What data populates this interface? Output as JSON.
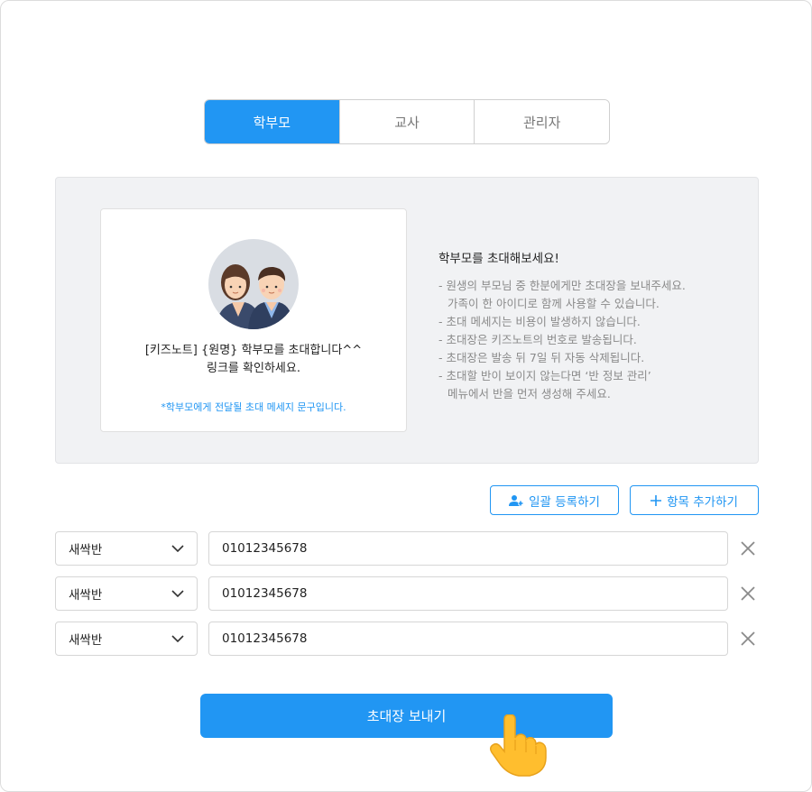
{
  "tabs": [
    {
      "label": "학부모",
      "active": true
    },
    {
      "label": "교사",
      "active": false
    },
    {
      "label": "관리자",
      "active": false
    }
  ],
  "preview": {
    "message_line1": "[키즈노트] {원명} 학부모를 초대합니다^^",
    "message_line2": "링크를 확인하세요.",
    "note": "*학부모에게 전달될 초대 메세지 문구입니다."
  },
  "info": {
    "title": "학부모를 초대해보세요!",
    "items": [
      "- 원생의 부모님 중 한분에게만 초대장을 보내주세요.",
      "가족이 한 아이디로 함께 사용할 수 있습니다.",
      "- 초대 메세지는 비용이 발생하지 않습니다.",
      "- 초대장은 키즈노트의 번호로 발송됩니다.",
      "- 초대장은 발송 뒤 7일 뒤 자동 삭제됩니다.",
      "- 초대할 반이 보이지 않는다면 ‘반 정보 관리’",
      "메뉴에서 반을 먼저 생성해 주세요."
    ]
  },
  "actions": {
    "bulk_label": "일괄 등록하기",
    "add_label": "항목 추가하기"
  },
  "rows": [
    {
      "class_name": "새싹반",
      "phone": "01012345678"
    },
    {
      "class_name": "새싹반",
      "phone": "01012345678"
    },
    {
      "class_name": "새싹반",
      "phone": "01012345678"
    }
  ],
  "submit_label": "초대장 보내기",
  "colors": {
    "accent": "#2196f3",
    "panel": "#f1f2f4"
  },
  "icons": [
    "user-plus-icon",
    "plus-icon",
    "chevron-down-icon",
    "close-icon",
    "pointing-hand-icon"
  ]
}
